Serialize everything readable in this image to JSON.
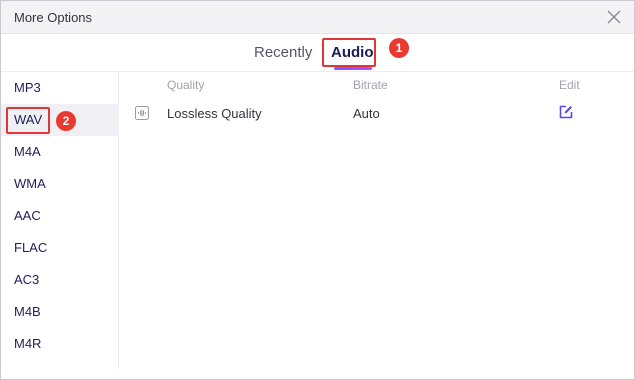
{
  "dialog": {
    "title": "More Options"
  },
  "tabs": [
    {
      "label": "Recently",
      "active": false
    },
    {
      "label": "Audio",
      "active": true
    }
  ],
  "annotations": {
    "marker_1": "1",
    "marker_2": "2"
  },
  "formats": [
    {
      "label": "MP3",
      "selected": false
    },
    {
      "label": "WAV",
      "selected": true
    },
    {
      "label": "M4A",
      "selected": false
    },
    {
      "label": "WMA",
      "selected": false
    },
    {
      "label": "AAC",
      "selected": false
    },
    {
      "label": "FLAC",
      "selected": false
    },
    {
      "label": "AC3",
      "selected": false
    },
    {
      "label": "M4B",
      "selected": false
    },
    {
      "label": "M4R",
      "selected": false
    }
  ],
  "table": {
    "headers": {
      "quality": "Quality",
      "bitrate": "Bitrate",
      "edit": "Edit"
    },
    "rows": [
      {
        "icon": "audio-wave-icon",
        "quality": "Lossless Quality",
        "bitrate": "Auto",
        "edit_icon": "edit-icon"
      }
    ]
  },
  "colors": {
    "accent_start": "#6f5cff",
    "accent_end": "#b64bff",
    "annotation_red": "#e03636",
    "selected_bg": "#f0f0f4",
    "format_text": "#1e1e5a"
  },
  "icons": {
    "close": "close-icon"
  }
}
